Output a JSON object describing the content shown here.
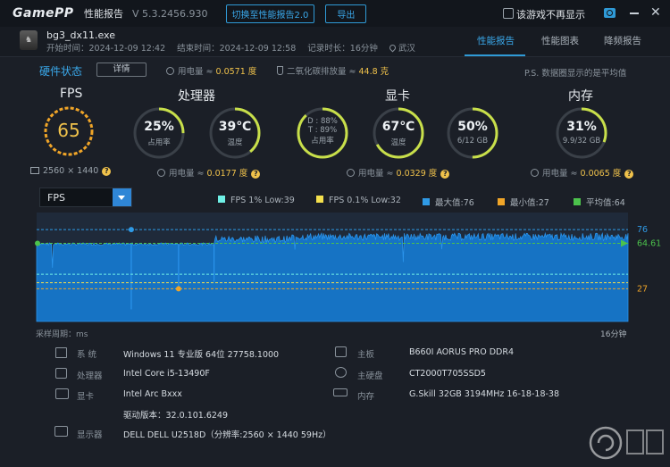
{
  "titlebar": {
    "logo": "GamePP",
    "app_name": "性能报告",
    "version": "V 5.3.2456.930",
    "switch_button": "切换至性能报告2.0",
    "export_button": "导出",
    "hide_in_game_label": "该游戏不再显示"
  },
  "session": {
    "exe": "bg3_dx11.exe",
    "start_time": "开始时间：2024-12-09 12:42",
    "end_time": "结束时间：2024-12-09 12:58",
    "duration": "记录时长：16分钟",
    "location": "武汉",
    "tabs": [
      "性能报告",
      "性能图表",
      "降频报告"
    ]
  },
  "hardware": {
    "title": "硬件状态",
    "detail_button": "详情",
    "power_label": "用电量 ≈ ",
    "power_value": "0.0571 度",
    "co2_label": "二氧化碳排放量 ≈ ",
    "co2_value": "44.8 克",
    "note": "P.S. 数据圈显示的是平均值"
  },
  "fps": {
    "title": "FPS",
    "value": "65",
    "resolution": "2560 × 1440"
  },
  "cpu": {
    "title": "处理器",
    "usage_value": "25%",
    "usage_label": "占用率",
    "usage_fraction": 0.25,
    "temp_value": "39℃",
    "temp_label": "温度",
    "temp_fraction": 0.39,
    "power_label": "用电量 ≈ ",
    "power_value": "0.0177 度"
  },
  "gpu": {
    "title": "显卡",
    "d_line": "D : 88%",
    "t_line": "T : 89%",
    "usage_label": "占用率",
    "usage_fraction": 0.88,
    "temp_value": "67℃",
    "temp_label": "温度",
    "temp_fraction": 0.67,
    "vram_value": "50%",
    "vram_label": "6/12 GB",
    "vram_fraction": 0.5,
    "power_label": "用电量 ≈ ",
    "power_value": "0.0329 度"
  },
  "memory": {
    "title": "内存",
    "value": "31%",
    "label": "9.9/32 GB",
    "fraction": 0.31,
    "power_label": "用电量 ≈ ",
    "power_value": "0.0065 度"
  },
  "chart_controls": {
    "metric": "FPS",
    "legend": [
      {
        "label": "FPS 1% Low:39",
        "color": "#6ff0e6"
      },
      {
        "label": "FPS 0.1% Low:32",
        "color": "#f4e04d"
      },
      {
        "label": "最大值:76",
        "color": "#2f9ae6"
      },
      {
        "label": "最小值:27",
        "color": "#f0a528"
      },
      {
        "label": "平均值:64",
        "color": "#4cc24c"
      }
    ],
    "sample_label": "采样周期：ms",
    "duration_label": "16分钟"
  },
  "chart_data": {
    "type": "area",
    "series": [
      {
        "name": "FPS",
        "color": "#1a86d6"
      }
    ],
    "ylim": [
      0,
      100
    ],
    "max": 76,
    "min": 27,
    "avg": 64.61,
    "low_1pct": 39,
    "low_01pct": 32,
    "reference_labels": [
      "76",
      "64.61",
      "27"
    ],
    "xlabel": "采样周期：ms",
    "x_end_label": "16分钟",
    "segments": [
      {
        "from": 0.0,
        "to": 0.3,
        "level": 64
      },
      {
        "from": 0.3,
        "to": 0.43,
        "level": 68
      },
      {
        "from": 0.43,
        "to": 1.0,
        "level": 70
      }
    ]
  },
  "specs": {
    "left": [
      {
        "key": "系 统",
        "value": "Windows 11 专业版 64位 27758.1000",
        "icon": "windows-icon"
      },
      {
        "key": "处理器",
        "value": "Intel Core i5-13490F",
        "icon": "cpu-icon"
      },
      {
        "key": "显卡",
        "value": "Intel Arc Bxxx",
        "icon": "gpu-icon"
      },
      {
        "key": "",
        "value": "驱动版本：32.0.101.6249",
        "icon": ""
      },
      {
        "key": "显示器",
        "value": "DELL DELL U2518D（分辨率:2560 × 1440 59Hz）",
        "icon": "monitor-icon"
      }
    ],
    "right": [
      {
        "key": "主板",
        "value": "B660I AORUS PRO DDR4",
        "icon": "motherboard-icon"
      },
      {
        "key": "主硬盘",
        "value": "CT2000T705SSD5",
        "icon": "disk-icon"
      },
      {
        "key": "内存",
        "value": "G.Skill 32GB 3194MHz 16-18-18-38",
        "icon": "ram-icon"
      }
    ]
  }
}
